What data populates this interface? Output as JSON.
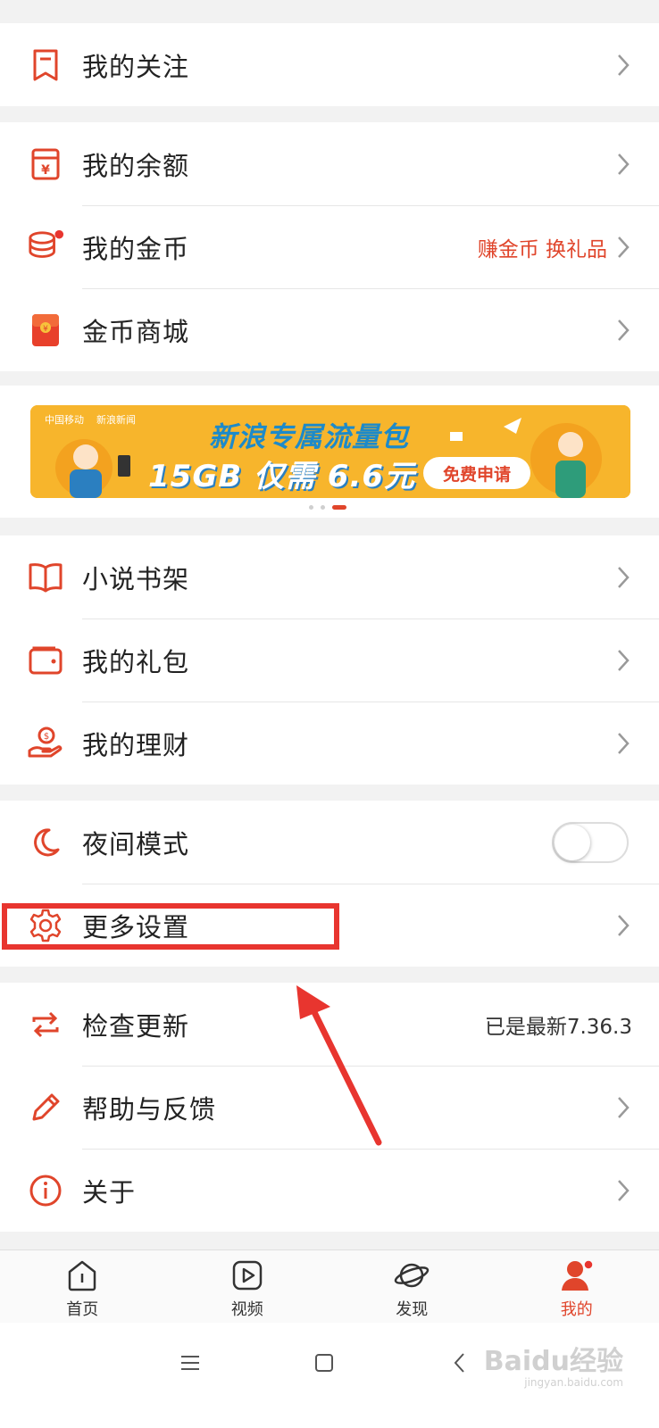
{
  "group1": {
    "follow": "我的关注"
  },
  "group2": {
    "balance": "我的余额",
    "coins": "我的金币",
    "coins_right": "赚金币 换礼品",
    "mall": "金币商城"
  },
  "banner": {
    "brand1": "中国移动",
    "brand2": "新浪新闻",
    "title": "新浪专属流量包",
    "subtitle": "15GB 仅需 6.6元",
    "button": "免费申请"
  },
  "group3": {
    "novel": "小说书架",
    "gift": "我的礼包",
    "finance": "我的理财"
  },
  "group4": {
    "night": "夜间模式",
    "night_on": false,
    "settings": "更多设置"
  },
  "group5": {
    "update": "检查更新",
    "update_right": "已是最新7.36.3",
    "help": "帮助与反馈",
    "about": "关于"
  },
  "tabs": {
    "home": "首页",
    "video": "视频",
    "discover": "发现",
    "mine": "我的"
  },
  "watermark": {
    "main": "Baidu经验",
    "sub": "jingyan.baidu.com"
  },
  "colors": {
    "accent": "#e0452b",
    "highlight": "#e8352f"
  }
}
